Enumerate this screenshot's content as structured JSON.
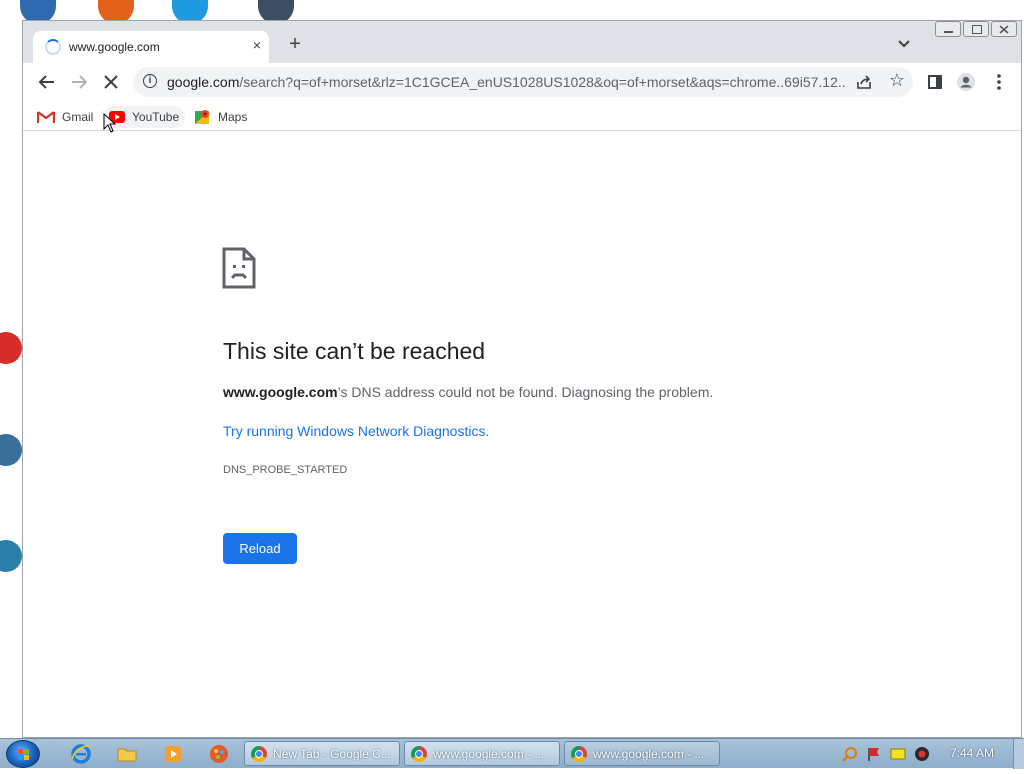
{
  "browser": {
    "tab": {
      "title": "www.google.com",
      "close_glyph": "×"
    },
    "new_tab_glyph": "+",
    "address": {
      "host": "google.com",
      "path": "/search?q=of+morset&rlz=1C1GCEA_enUS1028US1028&oq=of+morset&aqs=chrome..69i57.12..."
    },
    "bookmarks": [
      {
        "label": "Gmail",
        "icon": "gmail-icon"
      },
      {
        "label": "YouTube",
        "icon": "youtube-icon"
      },
      {
        "label": "Maps",
        "icon": "maps-icon"
      }
    ]
  },
  "error_page": {
    "title": "This site can’t be reached",
    "host_bold": "www.google.com",
    "desc_rest": "’s DNS address could not be found. Diagnosing the problem.",
    "link_text": "Try running Windows Network Diagnostics.",
    "error_code": "DNS_PROBE_STARTED",
    "reload_label": "Reload"
  },
  "taskbar": {
    "windows": [
      {
        "label": "New Tab - Google C...",
        "icon": "chrome-icon"
      },
      {
        "label": "www.google.com - ...",
        "icon": "chrome-icon"
      },
      {
        "label": "www.google.com - ...",
        "icon": "chrome-icon"
      }
    ],
    "clock": "7:44 AM"
  },
  "colors": {
    "accent": "#1a73e8",
    "tabstrip": "#dee1e6",
    "taskbar": "#a9c3da"
  }
}
